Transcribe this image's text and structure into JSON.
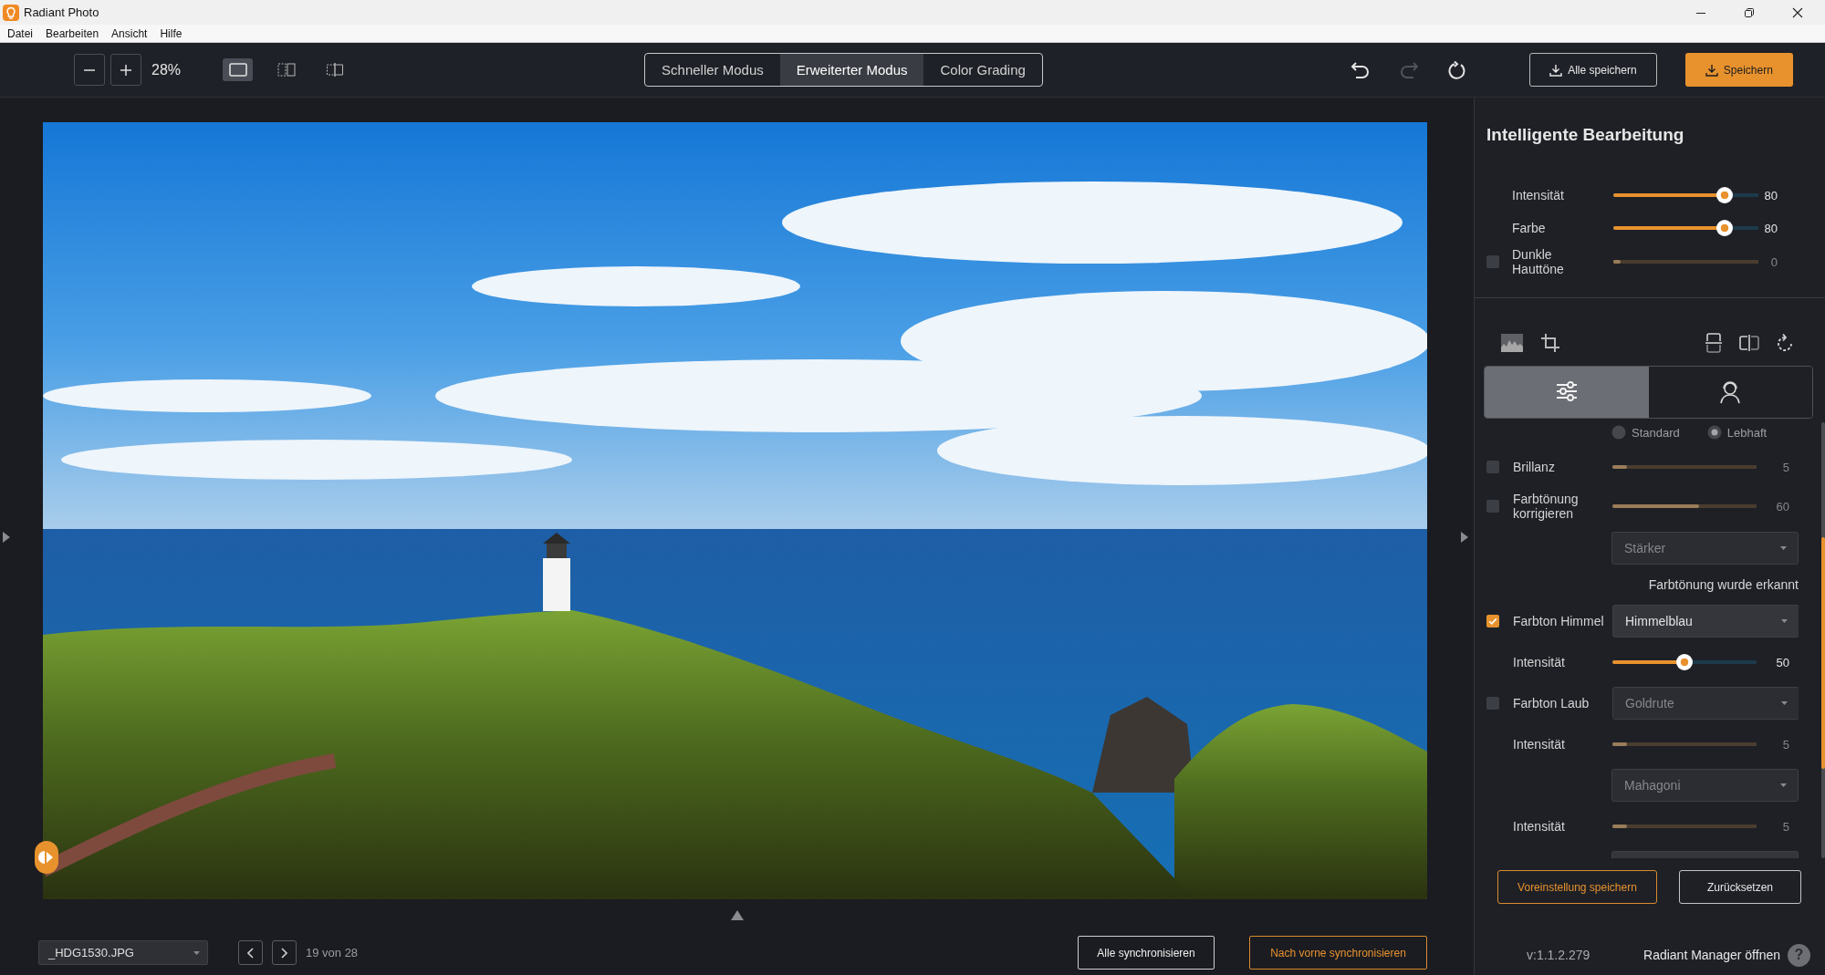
{
  "window": {
    "title": "Radiant Photo"
  },
  "menu": [
    {
      "label": "Datei"
    },
    {
      "label": "Bearbeiten"
    },
    {
      "label": "Ansicht"
    },
    {
      "label": "Hilfe"
    }
  ],
  "toolbar": {
    "zoom": "28%",
    "view_modes": [
      {
        "kind": "single",
        "selected": true
      },
      {
        "kind": "split",
        "selected": false
      },
      {
        "kind": "compare",
        "selected": false
      }
    ],
    "modes": [
      {
        "label": "Schneller Modus",
        "selected": false
      },
      {
        "label": "Erweiterter Modus",
        "selected": true
      },
      {
        "label": "Color Grading",
        "selected": false
      }
    ],
    "history": [
      {
        "kind": "undo",
        "disabled": false
      },
      {
        "kind": "redo",
        "disabled": true
      },
      {
        "kind": "reset",
        "disabled": false
      }
    ],
    "actions": [
      {
        "label": "Alle speichern",
        "kind": "outline"
      },
      {
        "label": "Speichern",
        "kind": "primary"
      }
    ]
  },
  "viewer": {
    "file": "_HDG1530.JPG",
    "counter": "19 von 28",
    "actions": [
      {
        "label": "Alle synchronisieren",
        "kind": "outline"
      },
      {
        "label": "Nach vorne synchronisieren",
        "kind": "accent"
      }
    ]
  },
  "panel": {
    "title": "Intelligente Bearbeitung",
    "smart": [
      {
        "kind": "slider",
        "label": "Intensität",
        "level": 0.8,
        "reading": "80",
        "disabled": false
      },
      {
        "kind": "slider",
        "label": "Farbe",
        "level": 0.8,
        "reading": "80",
        "disabled": false
      },
      {
        "kind": "check-slider",
        "label": "Dunkle Hauttöne",
        "checked": false,
        "level": 0.05,
        "reading": "0",
        "disabled": true
      }
    ],
    "tabs": [
      {
        "kind": "adjust",
        "selected": true
      },
      {
        "kind": "portrait",
        "selected": false
      }
    ],
    "adjustments": [
      {
        "kind": "radio",
        "options": [
          {
            "label": "Standard",
            "selected": false
          },
          {
            "label": "Lebhaft",
            "selected": true
          }
        ]
      },
      {
        "kind": "check-slider",
        "label": "Brillanz",
        "checked": false,
        "level": 0.1,
        "reading": "5",
        "disabled": true
      },
      {
        "kind": "check-slider",
        "label": "Farbtönung korrigieren",
        "checked": false,
        "level": 0.6,
        "reading": "60",
        "disabled": true
      },
      {
        "kind": "dropdown",
        "value": "Stärker",
        "disabled": true
      },
      {
        "kind": "note",
        "text": "Farbtönung wurde erkannt"
      },
      {
        "kind": "check-dropdown",
        "label": "Farbton Himmel",
        "checked": true,
        "value": "Himmelblau",
        "disabled": false
      },
      {
        "kind": "slider",
        "label": "Intensität",
        "level": 0.5,
        "reading": "50",
        "disabled": false
      },
      {
        "kind": "check-dropdown",
        "label": "Farbton Laub",
        "checked": false,
        "value": "Goldrute",
        "disabled": true
      },
      {
        "kind": "slider",
        "label": "Intensität",
        "level": 0.1,
        "reading": "5",
        "disabled": true
      },
      {
        "kind": "dropdown",
        "value": "Mahagoni",
        "disabled": true
      },
      {
        "kind": "slider",
        "label": "Intensität",
        "level": 0.1,
        "reading": "5",
        "disabled": true
      },
      {
        "kind": "dropdown"
      }
    ],
    "actions": [
      {
        "label": "Voreinstellung speichern",
        "kind": "accent"
      },
      {
        "label": "Zurücksetzen",
        "kind": "outline"
      }
    ],
    "version": "v:1.1.2.279",
    "manager_link": "Radiant Manager öffnen",
    "help": "?"
  }
}
